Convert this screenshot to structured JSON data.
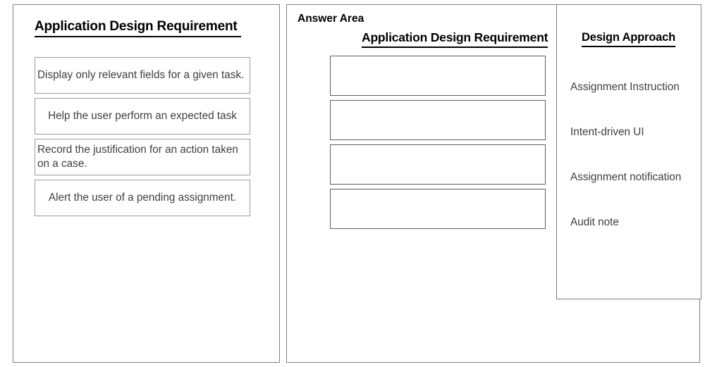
{
  "source_panel": {
    "heading": "Application Design Requirement ",
    "items": [
      {
        "text": "Display only relevant fields for a given task.",
        "align": "left"
      },
      {
        "text": "Help the user perform an expected task",
        "align": "center"
      },
      {
        "text": "Record the justification for an action taken on a case.",
        "align": "left"
      },
      {
        "text": "Alert the user of a pending assignment.",
        "align": "center"
      }
    ]
  },
  "answer_panel": {
    "area_label": "Answer Area",
    "column_heading": "Application Design Requirement",
    "dropzones": [
      {
        "value": ""
      },
      {
        "value": ""
      },
      {
        "value": ""
      },
      {
        "value": ""
      }
    ]
  },
  "approach_panel": {
    "heading": "Design Approach",
    "items": [
      {
        "text": "Assignment Instruction"
      },
      {
        "text": "Intent-driven UI"
      },
      {
        "text": "Assignment notification"
      },
      {
        "text": "Audit note"
      }
    ]
  },
  "colors": {
    "background": "#ffffff",
    "panel_border": "#808080",
    "item_border": "#9a9a9a",
    "dropzone_border": "#5e5e5e",
    "heading_text": "#000000",
    "body_text": "#3f3f3f"
  }
}
